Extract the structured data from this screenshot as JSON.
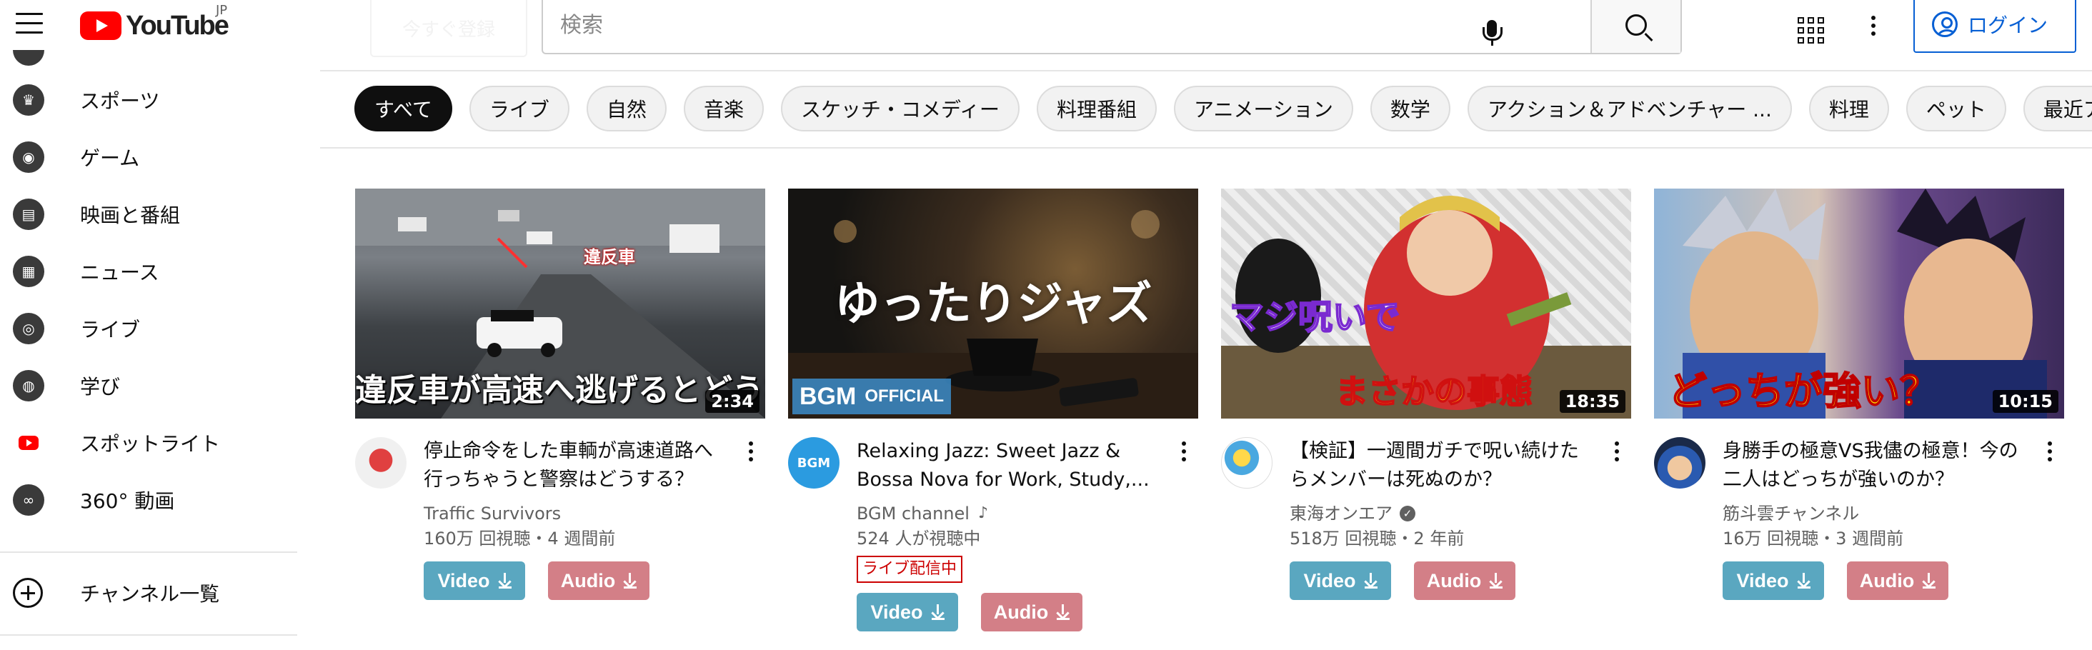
{
  "header": {
    "logo_text": "YouTube",
    "country_code": "JP",
    "ghost_button_label": "今すぐ登録",
    "search_placeholder": "検索",
    "login_label": "ログイン"
  },
  "sidebar": {
    "items": [
      {
        "label": "スポーツ",
        "icon": "trophy-icon"
      },
      {
        "label": "ゲーム",
        "icon": "gamepad-icon"
      },
      {
        "label": "映画と番組",
        "icon": "film-icon"
      },
      {
        "label": "ニュース",
        "icon": "newspaper-icon"
      },
      {
        "label": "ライブ",
        "icon": "live-broadcast-icon"
      },
      {
        "label": "学び",
        "icon": "lightbulb-icon"
      },
      {
        "label": "スポットライト",
        "icon": "youtube-spotlight-icon"
      },
      {
        "label": "360° 動画",
        "icon": "vr-360-icon"
      }
    ],
    "channels_label": "チャンネル一覧"
  },
  "chips": [
    "すべて",
    "ライブ",
    "自然",
    "音楽",
    "スケッチ・コメディー",
    "料理番組",
    "アニメーション",
    "数学",
    "アクション＆アドベンチャー ...",
    "料理",
    "ペット",
    "最近アップロー"
  ],
  "videos": [
    {
      "title": "停止命令をした車輌が高速道路へ行っちゃうと警察はどうする？",
      "channel": "Traffic Survivors",
      "stats": "160万 回視聴・4 週間前",
      "duration": "2:34",
      "thumb_text": "違反車が高速へ逃げるとどうなる？",
      "thumb_tag": "違反車"
    },
    {
      "title": "Relaxing Jazz: Sweet Jazz & Bossa Nova for Work, Study,...",
      "channel": "BGM channel",
      "stats": "524 人が視聴中",
      "live_badge": "ライブ配信中",
      "thumb_text": "ゆったりジャズ",
      "thumb_brand": "BGM",
      "thumb_official": "OFFICIAL"
    },
    {
      "title": "【検証】一週間ガチで呪い続けたらメンバーは死ぬのか？",
      "channel": "東海オンエア",
      "stats": "518万 回視聴・2 年前",
      "duration": "18:35",
      "thumb_text_top": "マジ呪いで",
      "thumb_text_bottom": "まさかの事態"
    },
    {
      "title": "身勝手の極意VS我儘の極意！今の二人はどっちが強いのか？",
      "channel": "筋斗雲チャンネル",
      "stats": "16万 回視聴・3 週間前",
      "duration": "10:15",
      "thumb_text": "どっちが強い？"
    }
  ],
  "download": {
    "video_label": "Video",
    "audio_label": "Audio"
  },
  "colors": {
    "brand_red": "#ff0000",
    "link_blue": "#065fd4",
    "video_button": "#5aa7c0",
    "audio_button": "#d37f87",
    "live_red": "#cc0000"
  }
}
